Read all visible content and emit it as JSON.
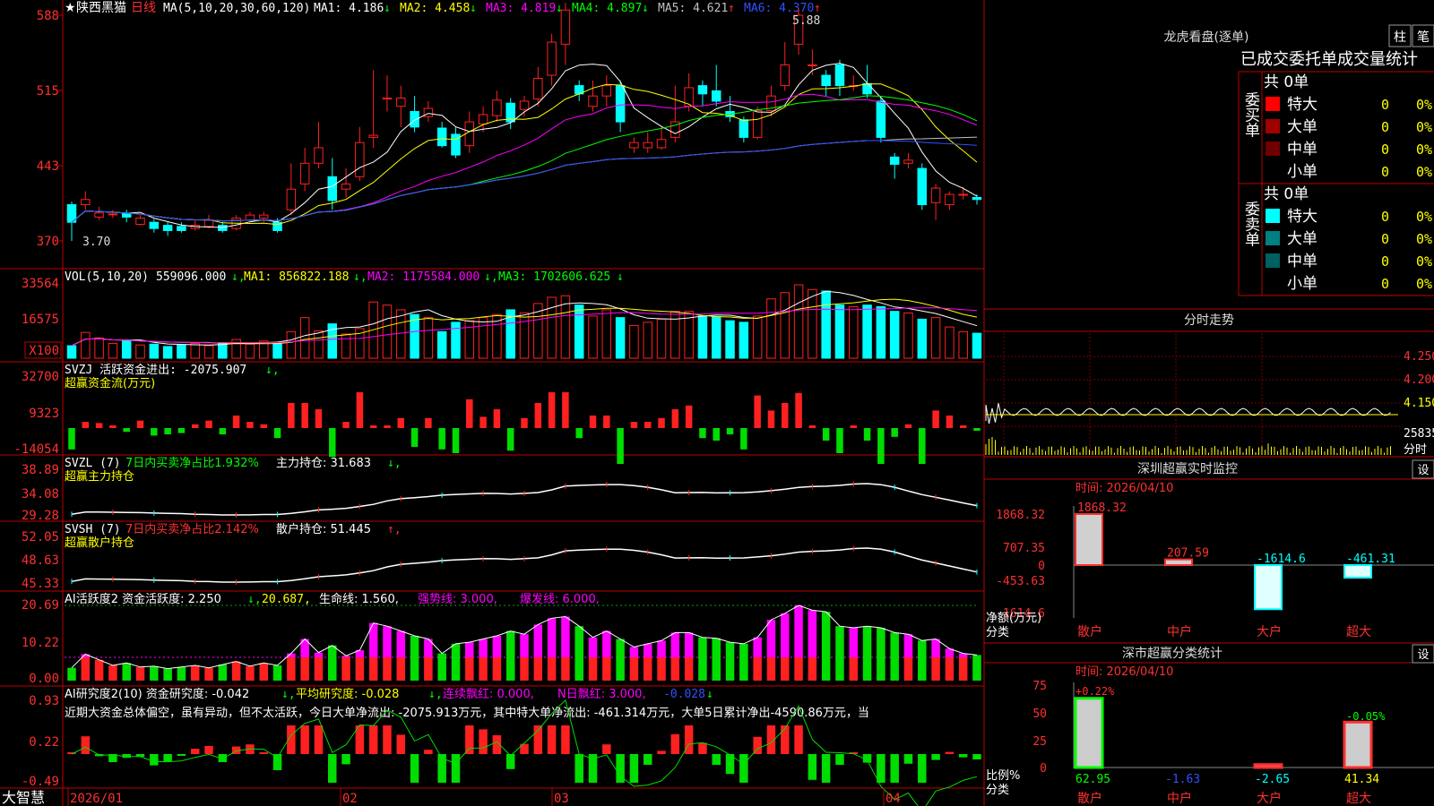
{
  "header": {
    "stock_name": "陕西黑猫",
    "period": "日线",
    "ma_label": "MA(5,10,20,30,60,120)",
    "ma": [
      {
        "name": "MA1",
        "value": "4.186",
        "arrow": "↓",
        "color": "#ffffff"
      },
      {
        "name": "MA2",
        "value": "4.458",
        "arrow": "↓",
        "color": "#ffff00"
      },
      {
        "name": "MA3",
        "value": "4.819",
        "arrow": "↓",
        "color": "#ff00ff"
      },
      {
        "name": "MA4",
        "value": "4.897",
        "arrow": "↓",
        "color": "#00ff00"
      },
      {
        "name": "MA5",
        "value": "4.621",
        "arrow": "↑",
        "color": "#c0c0c0"
      },
      {
        "name": "MA6",
        "value": "4.370",
        "arrow": "↑",
        "color": "#3050ff"
      }
    ]
  },
  "price_panel": {
    "y_ticks": [
      "588",
      "515",
      "443",
      "370"
    ],
    "high_mark": "5.88",
    "low_mark": "3.70"
  },
  "vol_panel": {
    "label": "VOL(5,10,20)",
    "value": "559096.000",
    "ma1": "MA1: 856822.188",
    "ma2": "MA2: 1175584.000",
    "ma3": "MA3: 1702606.625",
    "y_ticks": [
      "33564",
      "16575",
      "X100"
    ]
  },
  "svzj_panel": {
    "label": "SVZJ  活跃资金进出: -2075.907",
    "sub": "超赢资金流(万元)",
    "y_ticks": [
      "32700",
      "9323",
      "-14054"
    ]
  },
  "svzl_panel": {
    "label": "SVZL (7)",
    "green": "7日内买卖净占比1.932%",
    "white": "主力持仓: 31.683",
    "sub": "超赢主力持仓",
    "y_ticks": [
      "38.89",
      "34.08",
      "29.28"
    ]
  },
  "svsh_panel": {
    "label": "SVSH (7)",
    "red": "7日内买卖净占比2.142%",
    "white": "散户持仓: 51.445",
    "sub": "超赢散户持仓",
    "y_ticks": [
      "52.05",
      "48.63",
      "45.33"
    ]
  },
  "ai1_panel": {
    "label": "AI活跃度2 资金活跃度: 2.250",
    "v2": "20.687,",
    "v3": "生命线: 1.560,",
    "v4": "强势线: 3.000,",
    "v5": "爆发线: 6.000,",
    "y_ticks": [
      "20.69",
      "10.22",
      "0.00"
    ]
  },
  "ai2_panel": {
    "label": "AI研究度2(10) 资金研究度: -0.042",
    "v2": "平均研究度: -0.028",
    "v3": "连续飘红: 0.000,",
    "v4": "N日飘红: 3.000,",
    "v5": "-0.028",
    "text": "近期大资金总体偏空，虽有异动，但不太活跃，今日大单净流出: -2075.913万元，其中特大单净流出: -461.314万元，大单5日累计净出-4590.86万元，当",
    "y_ticks": [
      "0.93",
      "0.22",
      "-0.49"
    ]
  },
  "date_axis": [
    "2026/01",
    "02",
    "03",
    "04"
  ],
  "brand": "大智慧",
  "right": {
    "lhb_title": "龙虎看盘(逐单)",
    "btn_zhu": "柱",
    "btn_bi": "笔",
    "order_title": "已成交委托单成交量统计",
    "buy_label": "委买单",
    "sell_label": "委卖单",
    "buy_total": "共 0单",
    "sell_total": "共 0单",
    "buy_rows": [
      {
        "name": "特大",
        "count": "0",
        "pct": "0%",
        "color": "#ff0000"
      },
      {
        "name": "大单",
        "count": "0",
        "pct": "0%",
        "color": "#a00000"
      },
      {
        "name": "中单",
        "count": "0",
        "pct": "0%",
        "color": "#700000"
      },
      {
        "name": "小单",
        "count": "0",
        "pct": "0%",
        "color": ""
      }
    ],
    "sell_rows": [
      {
        "name": "特大",
        "count": "0",
        "pct": "0%",
        "color": "#00ffff"
      },
      {
        "name": "大单",
        "count": "0",
        "pct": "0%",
        "color": "#008080"
      },
      {
        "name": "中单",
        "count": "0",
        "pct": "0%",
        "color": "#006060"
      },
      {
        "name": "小单",
        "count": "0",
        "pct": "0%",
        "color": ""
      }
    ],
    "intraday_title": "分时走势",
    "intraday_ticks": [
      "4.250",
      "4.200",
      "4.150",
      "25835",
      "分时"
    ],
    "sz_title": "深圳超赢实时监控",
    "sz_btn": "设",
    "sz_time": "时间: 2026/04/10",
    "sz_ticks": [
      "1868.32",
      "707.35",
      "0",
      "-453.63",
      "-1614.6"
    ],
    "sz_values": [
      "1868.32",
      "207.59",
      "-1614.6",
      "-461.31"
    ],
    "sz_ylabel": "净额(万元)",
    "sz_xlabel": "分类",
    "sz_cats": [
      "散户",
      "中户",
      "大户",
      "超大"
    ],
    "sh_title": "深市超赢分类统计",
    "sh_btn": "设",
    "sh_time": "时间: 2026/04/10",
    "sh_ticks": [
      "75",
      "50",
      "25",
      "0"
    ],
    "sh_top": [
      "+0.22%",
      "-0.05%"
    ],
    "sh_values": [
      "62.95",
      "-1.63",
      "-2.65",
      "41.34"
    ],
    "sh_ylabel": "比例%",
    "sh_xlabel": "分类",
    "sh_cats": [
      "散户",
      "中户",
      "大户",
      "超大"
    ]
  },
  "chart_data": {
    "type": "candlestick",
    "candles": [
      [
        4.05,
        3.88,
        4.08,
        3.7
      ],
      [
        4.05,
        4.1,
        4.18,
        4.0
      ],
      [
        3.93,
        3.97,
        4.03,
        3.9
      ],
      [
        3.96,
        3.96,
        4.0,
        3.92
      ],
      [
        3.96,
        3.93,
        4.0,
        3.88
      ],
      [
        3.86,
        3.92,
        3.95,
        3.85
      ],
      [
        3.88,
        3.82,
        3.91,
        3.78
      ],
      [
        3.85,
        3.8,
        3.88,
        3.75
      ],
      [
        3.84,
        3.8,
        3.88,
        3.78
      ],
      [
        3.82,
        3.85,
        3.9,
        3.8
      ],
      [
        3.84,
        3.9,
        3.95,
        3.82
      ],
      [
        3.85,
        3.8,
        3.88,
        3.78
      ],
      [
        3.82,
        3.92,
        3.95,
        3.8
      ],
      [
        3.9,
        3.95,
        3.98,
        3.88
      ],
      [
        3.92,
        3.95,
        3.98,
        3.88
      ],
      [
        3.88,
        3.8,
        3.92,
        3.78
      ],
      [
        4.0,
        4.2,
        4.45,
        3.95
      ],
      [
        4.25,
        4.45,
        4.6,
        4.18
      ],
      [
        4.45,
        4.6,
        4.85,
        4.4
      ],
      [
        4.32,
        4.09,
        4.5,
        4.0
      ],
      [
        4.2,
        4.25,
        4.4,
        4.12
      ],
      [
        4.32,
        4.65,
        4.8,
        4.28
      ],
      [
        4.7,
        4.72,
        5.35,
        4.6
      ],
      [
        5.07,
        5.08,
        5.3,
        4.95
      ],
      [
        5.0,
        5.08,
        5.2,
        4.8
      ],
      [
        4.95,
        4.8,
        5.1,
        4.75
      ],
      [
        4.9,
        4.98,
        5.05,
        4.85
      ],
      [
        4.79,
        4.62,
        4.85,
        4.6
      ],
      [
        4.73,
        4.53,
        4.8,
        4.5
      ],
      [
        4.62,
        4.85,
        4.95,
        4.55
      ],
      [
        4.83,
        4.92,
        5.0,
        4.75
      ],
      [
        4.91,
        5.06,
        5.15,
        4.85
      ],
      [
        5.03,
        4.85,
        5.08,
        4.78
      ],
      [
        4.97,
        5.05,
        5.1,
        4.9
      ],
      [
        5.07,
        5.27,
        5.38,
        5.0
      ],
      [
        5.3,
        5.62,
        5.7,
        5.2
      ],
      [
        5.6,
        5.93,
        6.0,
        5.4
      ],
      [
        5.2,
        5.12,
        5.25,
        5.05
      ],
      [
        5.0,
        5.1,
        5.25,
        4.95
      ],
      [
        5.1,
        5.2,
        5.3,
        5.0
      ],
      [
        5.2,
        4.85,
        5.25,
        4.75
      ],
      [
        4.6,
        4.65,
        4.7,
        4.55
      ],
      [
        4.6,
        4.65,
        4.75,
        4.55
      ],
      [
        4.6,
        4.68,
        4.8,
        4.58
      ],
      [
        4.7,
        4.85,
        5.2,
        4.65
      ],
      [
        5.0,
        5.18,
        5.32,
        4.95
      ],
      [
        5.2,
        5.12,
        5.25,
        5.0
      ],
      [
        5.15,
        5.05,
        5.4,
        5.0
      ],
      [
        4.95,
        4.9,
        5.1,
        4.85
      ],
      [
        4.87,
        4.7,
        4.9,
        4.65
      ],
      [
        4.7,
        4.96,
        5.0,
        4.68
      ],
      [
        4.96,
        5.1,
        5.2,
        4.9
      ],
      [
        5.2,
        5.4,
        5.62,
        5.15
      ],
      [
        5.6,
        5.88,
        5.95,
        5.5
      ],
      [
        5.4,
        5.4,
        5.55,
        5.3
      ],
      [
        5.3,
        5.2,
        5.35,
        5.1
      ],
      [
        5.4,
        5.2,
        5.45,
        5.1
      ],
      [
        5.2,
        5.2,
        5.3,
        5.15
      ],
      [
        5.22,
        5.12,
        5.4,
        5.08
      ],
      [
        5.05,
        4.7,
        5.1,
        4.65
      ],
      [
        4.51,
        4.44,
        4.55,
        4.3
      ],
      [
        4.45,
        4.48,
        4.55,
        4.4
      ],
      [
        4.4,
        4.05,
        4.45,
        4.0
      ],
      [
        4.07,
        4.21,
        4.25,
        3.9
      ],
      [
        4.05,
        4.15,
        4.18,
        4.0
      ],
      [
        4.15,
        4.15,
        4.22,
        4.1
      ],
      [
        4.12,
        4.1,
        4.15,
        4.05
      ]
    ],
    "volume": [
      80,
      165,
      130,
      95,
      110,
      85,
      90,
      75,
      85,
      95,
      80,
      100,
      120,
      90,
      110,
      95,
      170,
      260,
      175,
      220,
      155,
      190,
      360,
      340,
      310,
      280,
      260,
      170,
      230,
      240,
      260,
      280,
      310,
      290,
      350,
      390,
      400,
      340,
      270,
      310,
      260,
      210,
      230,
      250,
      300,
      300,
      270,
      265,
      240,
      230,
      270,
      380,
      420,
      470,
      440,
      430,
      340,
      330,
      340,
      330,
      300,
      290,
      250,
      260,
      200,
      170,
      160
    ]
  },
  "y_axis": {
    "price_range": [
      3.7,
      5.88
    ]
  }
}
